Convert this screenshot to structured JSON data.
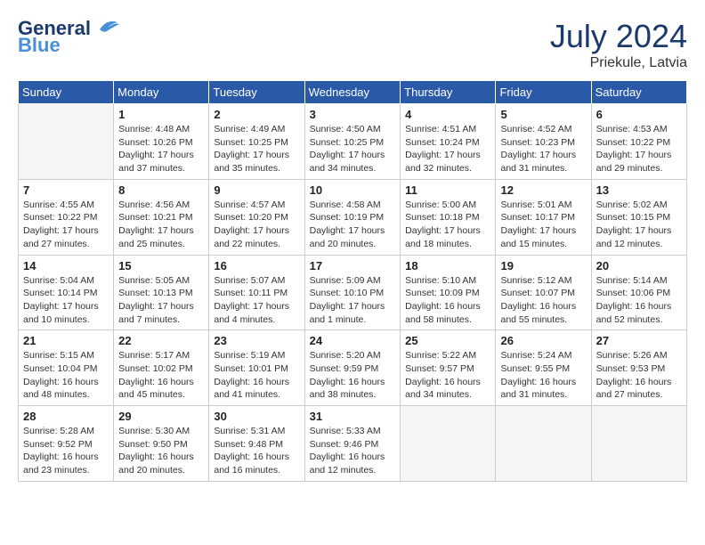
{
  "header": {
    "logo_line1": "General",
    "logo_line2": "Blue",
    "month": "July 2024",
    "location": "Priekule, Latvia"
  },
  "weekdays": [
    "Sunday",
    "Monday",
    "Tuesday",
    "Wednesday",
    "Thursday",
    "Friday",
    "Saturday"
  ],
  "weeks": [
    [
      {
        "day": "",
        "info": ""
      },
      {
        "day": "1",
        "info": "Sunrise: 4:48 AM\nSunset: 10:26 PM\nDaylight: 17 hours\nand 37 minutes."
      },
      {
        "day": "2",
        "info": "Sunrise: 4:49 AM\nSunset: 10:25 PM\nDaylight: 17 hours\nand 35 minutes."
      },
      {
        "day": "3",
        "info": "Sunrise: 4:50 AM\nSunset: 10:25 PM\nDaylight: 17 hours\nand 34 minutes."
      },
      {
        "day": "4",
        "info": "Sunrise: 4:51 AM\nSunset: 10:24 PM\nDaylight: 17 hours\nand 32 minutes."
      },
      {
        "day": "5",
        "info": "Sunrise: 4:52 AM\nSunset: 10:23 PM\nDaylight: 17 hours\nand 31 minutes."
      },
      {
        "day": "6",
        "info": "Sunrise: 4:53 AM\nSunset: 10:22 PM\nDaylight: 17 hours\nand 29 minutes."
      }
    ],
    [
      {
        "day": "7",
        "info": "Sunrise: 4:55 AM\nSunset: 10:22 PM\nDaylight: 17 hours\nand 27 minutes."
      },
      {
        "day": "8",
        "info": "Sunrise: 4:56 AM\nSunset: 10:21 PM\nDaylight: 17 hours\nand 25 minutes."
      },
      {
        "day": "9",
        "info": "Sunrise: 4:57 AM\nSunset: 10:20 PM\nDaylight: 17 hours\nand 22 minutes."
      },
      {
        "day": "10",
        "info": "Sunrise: 4:58 AM\nSunset: 10:19 PM\nDaylight: 17 hours\nand 20 minutes."
      },
      {
        "day": "11",
        "info": "Sunrise: 5:00 AM\nSunset: 10:18 PM\nDaylight: 17 hours\nand 18 minutes."
      },
      {
        "day": "12",
        "info": "Sunrise: 5:01 AM\nSunset: 10:17 PM\nDaylight: 17 hours\nand 15 minutes."
      },
      {
        "day": "13",
        "info": "Sunrise: 5:02 AM\nSunset: 10:15 PM\nDaylight: 17 hours\nand 12 minutes."
      }
    ],
    [
      {
        "day": "14",
        "info": "Sunrise: 5:04 AM\nSunset: 10:14 PM\nDaylight: 17 hours\nand 10 minutes."
      },
      {
        "day": "15",
        "info": "Sunrise: 5:05 AM\nSunset: 10:13 PM\nDaylight: 17 hours\nand 7 minutes."
      },
      {
        "day": "16",
        "info": "Sunrise: 5:07 AM\nSunset: 10:11 PM\nDaylight: 17 hours\nand 4 minutes."
      },
      {
        "day": "17",
        "info": "Sunrise: 5:09 AM\nSunset: 10:10 PM\nDaylight: 17 hours\nand 1 minute."
      },
      {
        "day": "18",
        "info": "Sunrise: 5:10 AM\nSunset: 10:09 PM\nDaylight: 16 hours\nand 58 minutes."
      },
      {
        "day": "19",
        "info": "Sunrise: 5:12 AM\nSunset: 10:07 PM\nDaylight: 16 hours\nand 55 minutes."
      },
      {
        "day": "20",
        "info": "Sunrise: 5:14 AM\nSunset: 10:06 PM\nDaylight: 16 hours\nand 52 minutes."
      }
    ],
    [
      {
        "day": "21",
        "info": "Sunrise: 5:15 AM\nSunset: 10:04 PM\nDaylight: 16 hours\nand 48 minutes."
      },
      {
        "day": "22",
        "info": "Sunrise: 5:17 AM\nSunset: 10:02 PM\nDaylight: 16 hours\nand 45 minutes."
      },
      {
        "day": "23",
        "info": "Sunrise: 5:19 AM\nSunset: 10:01 PM\nDaylight: 16 hours\nand 41 minutes."
      },
      {
        "day": "24",
        "info": "Sunrise: 5:20 AM\nSunset: 9:59 PM\nDaylight: 16 hours\nand 38 minutes."
      },
      {
        "day": "25",
        "info": "Sunrise: 5:22 AM\nSunset: 9:57 PM\nDaylight: 16 hours\nand 34 minutes."
      },
      {
        "day": "26",
        "info": "Sunrise: 5:24 AM\nSunset: 9:55 PM\nDaylight: 16 hours\nand 31 minutes."
      },
      {
        "day": "27",
        "info": "Sunrise: 5:26 AM\nSunset: 9:53 PM\nDaylight: 16 hours\nand 27 minutes."
      }
    ],
    [
      {
        "day": "28",
        "info": "Sunrise: 5:28 AM\nSunset: 9:52 PM\nDaylight: 16 hours\nand 23 minutes."
      },
      {
        "day": "29",
        "info": "Sunrise: 5:30 AM\nSunset: 9:50 PM\nDaylight: 16 hours\nand 20 minutes."
      },
      {
        "day": "30",
        "info": "Sunrise: 5:31 AM\nSunset: 9:48 PM\nDaylight: 16 hours\nand 16 minutes."
      },
      {
        "day": "31",
        "info": "Sunrise: 5:33 AM\nSunset: 9:46 PM\nDaylight: 16 hours\nand 12 minutes."
      },
      {
        "day": "",
        "info": ""
      },
      {
        "day": "",
        "info": ""
      },
      {
        "day": "",
        "info": ""
      }
    ]
  ]
}
